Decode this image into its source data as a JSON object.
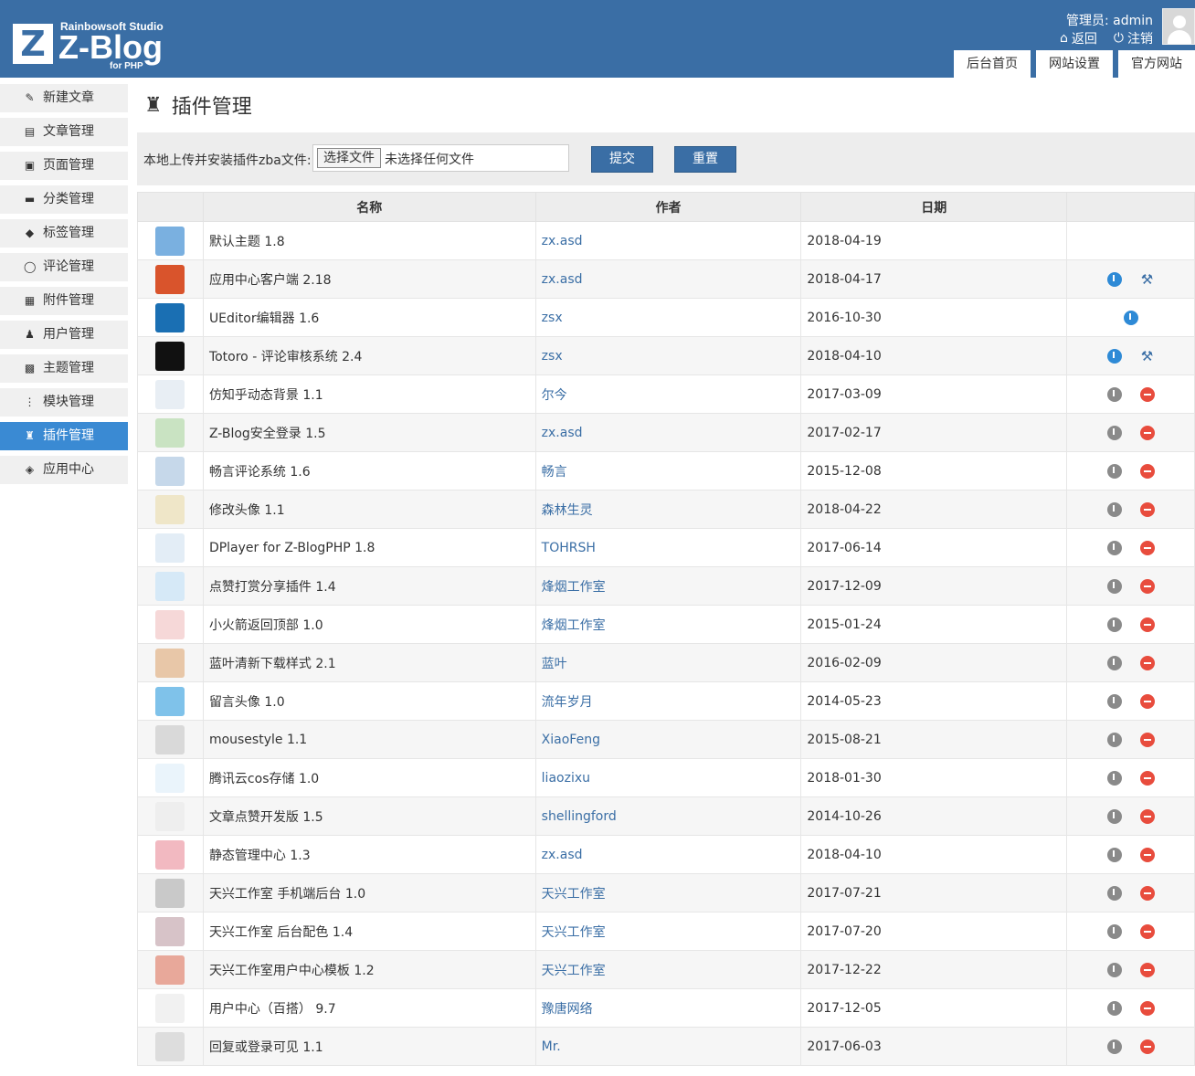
{
  "header": {
    "logo": {
      "studio": "Rainbowsoft Studio",
      "name": "Z-Blog",
      "sub": "for PHP",
      "mark": "Z"
    },
    "user_label": "管理员: admin",
    "back_label": "返回",
    "logout_label": "注销",
    "tabs": [
      "后台首页",
      "网站设置",
      "官方网站"
    ]
  },
  "sidebar": {
    "items": [
      {
        "label": "新建文章",
        "icon": "edit-icon"
      },
      {
        "label": "文章管理",
        "icon": "article-icon"
      },
      {
        "label": "页面管理",
        "icon": "page-icon"
      },
      {
        "label": "分类管理",
        "icon": "folder-icon"
      },
      {
        "label": "标签管理",
        "icon": "tag-icon"
      },
      {
        "label": "评论管理",
        "icon": "comment-icon"
      },
      {
        "label": "附件管理",
        "icon": "attachment-icon"
      },
      {
        "label": "用户管理",
        "icon": "user-icon"
      },
      {
        "label": "主题管理",
        "icon": "theme-icon"
      },
      {
        "label": "模块管理",
        "icon": "module-icon"
      },
      {
        "label": "插件管理",
        "icon": "plugin-icon"
      },
      {
        "label": "应用中心",
        "icon": "appcenter-icon"
      }
    ]
  },
  "page": {
    "title": "插件管理",
    "upload_label": "本地上传并安装插件zba文件:",
    "file_button": "选择文件",
    "file_status": "未选择任何文件",
    "submit": "提交",
    "reset": "重置"
  },
  "table": {
    "headers": [
      "",
      "名称",
      "作者",
      "日期",
      ""
    ],
    "rows": [
      {
        "name": "默认主题 1.8",
        "author": "zx.asd",
        "date": "2018-04-19",
        "icon_color": "#7ab0e0",
        "actions": []
      },
      {
        "name": "应用中心客户端 2.18",
        "author": "zx.asd",
        "date": "2018-04-17",
        "icon_color": "#d9542c",
        "actions": [
          "power-blue",
          "tool"
        ]
      },
      {
        "name": "UEditor编辑器 1.6",
        "author": "zsx",
        "date": "2016-10-30",
        "icon_color": "#1a6fb3",
        "actions": [
          "power-blue"
        ]
      },
      {
        "name": "Totoro - 评论审核系统 2.4",
        "author": "zsx",
        "date": "2018-04-10",
        "icon_color": "#111111",
        "actions": [
          "power-blue",
          "tool"
        ]
      },
      {
        "name": "仿知乎动态背景 1.1",
        "author": "尔今",
        "date": "2017-03-09",
        "icon_color": "#e8eef4",
        "actions": [
          "power-grey",
          "delete"
        ]
      },
      {
        "name": "Z-Blog安全登录 1.5",
        "author": "zx.asd",
        "date": "2017-02-17",
        "icon_color": "#c9e3c2",
        "actions": [
          "power-grey",
          "delete"
        ]
      },
      {
        "name": "畅言评论系统 1.6",
        "author": "畅言",
        "date": "2015-12-08",
        "icon_color": "#c6d8ea",
        "actions": [
          "power-grey",
          "delete"
        ]
      },
      {
        "name": "修改头像 1.1",
        "author": "森林生灵",
        "date": "2018-04-22",
        "icon_color": "#efe6c8",
        "actions": [
          "power-grey",
          "delete"
        ]
      },
      {
        "name": "DPlayer for Z-BlogPHP 1.8",
        "author": "TOHRSH",
        "date": "2017-06-14",
        "icon_color": "#e3edf6",
        "actions": [
          "power-grey",
          "delete"
        ]
      },
      {
        "name": "点赞打赏分享插件 1.4",
        "author": "烽烟工作室",
        "date": "2017-12-09",
        "icon_color": "#d6e9f7",
        "actions": [
          "power-grey",
          "delete"
        ]
      },
      {
        "name": "小火箭返回顶部 1.0",
        "author": "烽烟工作室",
        "date": "2015-01-24",
        "icon_color": "#f6d8d8",
        "actions": [
          "power-grey",
          "delete"
        ]
      },
      {
        "name": "蓝叶清新下载样式 2.1",
        "author": "蓝叶",
        "date": "2016-02-09",
        "icon_color": "#e8c7a8",
        "actions": [
          "power-grey",
          "delete"
        ]
      },
      {
        "name": "留言头像 1.0",
        "author": "流年岁月",
        "date": "2014-05-23",
        "icon_color": "#7fc2ea",
        "actions": [
          "power-grey",
          "delete"
        ]
      },
      {
        "name": "mousestyle 1.1",
        "author": "XiaoFeng",
        "date": "2015-08-21",
        "icon_color": "#d9d9d9",
        "actions": [
          "power-grey",
          "delete"
        ]
      },
      {
        "name": "腾讯云cos存储 1.0",
        "author": "liaozixu",
        "date": "2018-01-30",
        "icon_color": "#eaf4fb",
        "actions": [
          "power-grey",
          "delete"
        ]
      },
      {
        "name": "文章点赞开发版 1.5",
        "author": "shellingford",
        "date": "2014-10-26",
        "icon_color": "#eeeeee",
        "actions": [
          "power-grey",
          "delete"
        ]
      },
      {
        "name": "静态管理中心 1.3",
        "author": "zx.asd",
        "date": "2018-04-10",
        "icon_color": "#f2b9c1",
        "actions": [
          "power-grey",
          "delete"
        ]
      },
      {
        "name": "天兴工作室 手机端后台 1.0",
        "author": "天兴工作室",
        "date": "2017-07-21",
        "icon_color": "#c9c9c9",
        "actions": [
          "power-grey",
          "delete"
        ]
      },
      {
        "name": "天兴工作室 后台配色 1.4",
        "author": "天兴工作室",
        "date": "2017-07-20",
        "icon_color": "#d7c3c8",
        "actions": [
          "power-grey",
          "delete"
        ]
      },
      {
        "name": "天兴工作室用户中心模板 1.2",
        "author": "天兴工作室",
        "date": "2017-12-22",
        "icon_color": "#e8a89a",
        "actions": [
          "power-grey",
          "delete"
        ]
      },
      {
        "name": "用户中心（百搭） 9.7",
        "author": "豫唐网络",
        "date": "2017-12-05",
        "icon_color": "#f1f1f1",
        "actions": [
          "power-grey",
          "delete"
        ]
      },
      {
        "name": "回复或登录可见 1.1",
        "author": "Mr.",
        "date": "2017-06-03",
        "icon_color": "#dddddd",
        "actions": [
          "power-grey",
          "delete"
        ]
      }
    ]
  },
  "colors": {
    "header": "#3a6ea5",
    "active": "#3a8ad3",
    "link": "#3a6ea5",
    "delete": "#e84c3d"
  }
}
